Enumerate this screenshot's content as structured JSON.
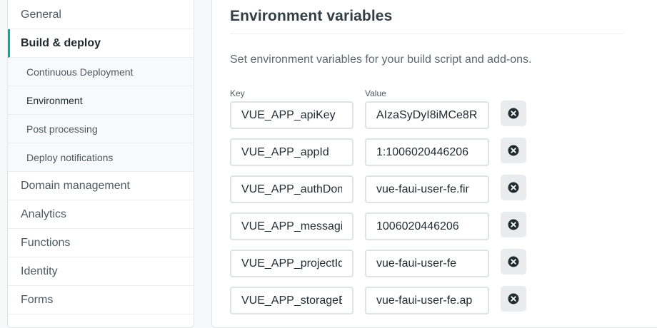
{
  "sidebar": {
    "items": [
      {
        "label": "General"
      },
      {
        "label": "Build & deploy",
        "active": true,
        "children": [
          {
            "label": "Continuous Deployment"
          },
          {
            "label": "Environment",
            "current": true
          },
          {
            "label": "Post processing"
          },
          {
            "label": "Deploy notifications"
          }
        ]
      },
      {
        "label": "Domain management"
      },
      {
        "label": "Analytics"
      },
      {
        "label": "Functions"
      },
      {
        "label": "Identity"
      },
      {
        "label": "Forms"
      }
    ]
  },
  "section": {
    "title": "Environment variables",
    "description": "Set environment variables for your build script and add-ons.",
    "key_label": "Key",
    "value_label": "Value"
  },
  "variables": [
    {
      "key": "VUE_APP_apiKey",
      "value": "AIzaSyDyI8iMCe8R"
    },
    {
      "key": "VUE_APP_appId",
      "value": "1:1006020446206"
    },
    {
      "key": "VUE_APP_authDom",
      "value": "vue-faui-user-fe.fir"
    },
    {
      "key": "VUE_APP_messagir",
      "value": "1006020446206"
    },
    {
      "key": "VUE_APP_projectId",
      "value": "vue-faui-user-fe"
    },
    {
      "key": "VUE_APP_storageB",
      "value": "vue-faui-user-fe.ap"
    }
  ],
  "colors": {
    "accent": "#00ad9f",
    "remove_button_bg": "#e9ebec",
    "remove_icon": "#1f2b30"
  },
  "icons": {
    "remove": "close-circle-icon"
  }
}
